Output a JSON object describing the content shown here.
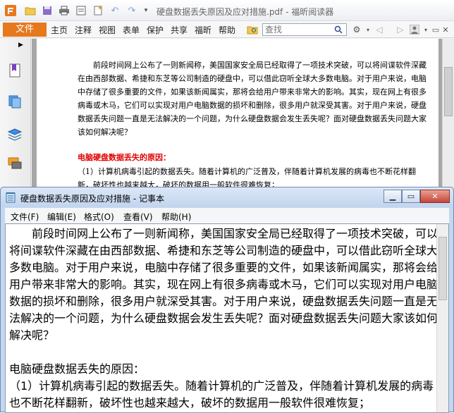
{
  "foxit": {
    "title": "硬盘数据丢失原因及应对措施.pdf - 福昕阅读器",
    "file_tab": "文件",
    "menu": [
      "主页",
      "注释",
      "视图",
      "表单",
      "保护",
      "共享",
      "福昕",
      "帮助"
    ],
    "search_placeholder": "查找",
    "pdf_paragraph": "前段时间网上公布了一则新闻称，美国国家安全局已经取得了一项技术突破，可以将间谍软件深藏在由西部数据、希捷和东芝等公司制造的硬盘中，可以借此窃听全球大多数电脑。对于用户来说，电脑中存储了很多重要的文件，如果该新闻属实，那将会给用户带来非常大的影响。其实，现在网上有很多病毒或木马，它们可以实现对用户电脑数据的损坏和删除，很多用户就深受其害。对于用户来说，硬盘数据丢失问题一直是无法解决的一个问题，为什么硬盘数据会发生丢失呢？面对硬盘数据丢失问题大家该如何解决呢？",
    "pdf_heading": "电脑硬盘数据丢失的原因：",
    "pdf_paragraph2": "（1）计算机病毒引起的数据丢失。随着计算机的广泛普及，伴随着计算机发展的病毒也不断花样翻新，破坏性也越来越大，破坏的数据用一般软件很难恢复；"
  },
  "notepad": {
    "title": "硬盘数据丢失原因及应对措施 - 记事本",
    "menu": [
      "文件(F)",
      "编辑(E)",
      "格式(O)",
      "查看(V)",
      "帮助(H)"
    ],
    "content": "　　前段时间网上公布了一则新闻称，美国国家安全局已经取得了一项技术突破，可以将间谍软件深藏在由西部数据、希捷和东芝等公司制造的硬盘中，可以借此窃听全球大多数电脑。对于用户来说，电脑中存储了很多重要的文件，如果该新闻属实，那将会给用户带来非常大的影响。其实，现在网上有很多病毒或木马，它们可以实现对用户电脑数据的损坏和删除，很多用户就深受其害。对于用户来说，硬盘数据丢失问题一直是无法解决的一个问题，为什么硬盘数据会发生丢失呢？面对硬盘数据丢失问题大家该如何解决呢？\n\n电脑硬盘数据丢失的原因：\n（1）计算机病毒引起的数据丢失。随着计算机的广泛普及，伴随着计算机发展的病毒也不断花样翻新，破坏性也越来越大，破坏的数据用一般软件很难恢复；"
  },
  "colors": {
    "foxit_accent": "#e6781d",
    "pdf_heading": "#e00000",
    "notepad_frame": "#c5d7ee"
  }
}
